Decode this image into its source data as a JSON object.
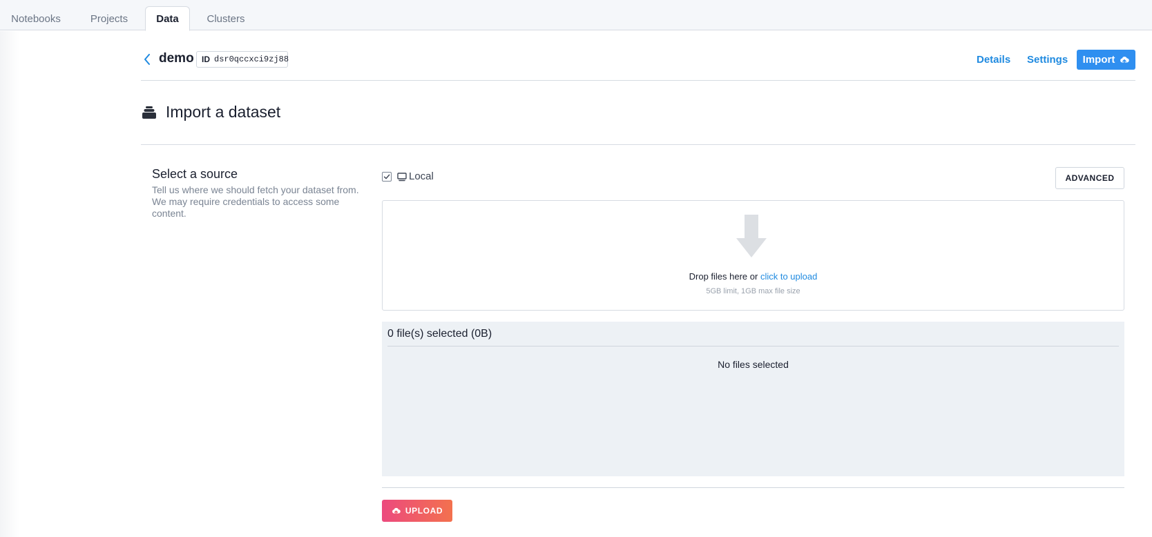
{
  "tabs": [
    {
      "label": "Notebooks",
      "active": false
    },
    {
      "label": "Projects",
      "active": false
    },
    {
      "label": "Data",
      "active": true
    },
    {
      "label": "Clusters",
      "active": false
    }
  ],
  "header": {
    "dataset_name": "demo",
    "id_label": "ID",
    "id_value": "dsr0qccxci9zj88",
    "details_label": "Details",
    "settings_label": "Settings",
    "import_label": "Import"
  },
  "page": {
    "title": "Import a dataset"
  },
  "source": {
    "title": "Select a source",
    "description": "Tell us where we should fetch your dataset from. We may require credentials to access some content.",
    "local_label": "Local",
    "local_checked": true,
    "advanced_label": "ADVANCED"
  },
  "dropzone": {
    "text": "Drop files here or",
    "link_text": "click to upload",
    "limit_text": "5GB limit, 1GB max file size"
  },
  "files": {
    "count_text": "0 file(s) selected (0B)",
    "empty_text": "No files selected"
  },
  "upload": {
    "label": "UPLOAD"
  },
  "colors": {
    "accent": "#2f8ff0",
    "link": "#1f8ae0",
    "upload_gradient_start": "#ec4a7e",
    "upload_gradient_end": "#f3714e"
  },
  "icons": {
    "back": "chevron-left-icon",
    "page": "database-icon",
    "import": "cloud-upload-icon",
    "local": "monitor-icon",
    "drop": "arrow-down-icon",
    "upload": "cloud-upload-icon"
  }
}
